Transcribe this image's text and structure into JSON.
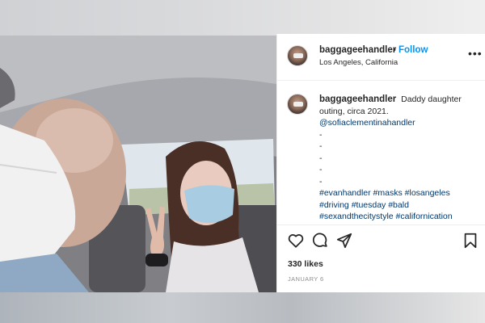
{
  "post": {
    "username": "baggageehandler",
    "dot": "•",
    "follow_label": "Follow",
    "location": "Los Angeles, California",
    "more_label": "•••",
    "caption": {
      "username": "baggageehandler",
      "text": "Daddy daughter outing, circa 2021.",
      "mention": "@sofiaclementinahandler",
      "dashes": [
        "-",
        "-",
        "-",
        "-",
        "-"
      ],
      "hashtags_line1": "#evanhandler #masks #losangeles",
      "hashtags_line2": "#driving #tuesday #bald",
      "hashtags_line3": "#sexandthecitystyle #californication"
    },
    "likes": "330 likes",
    "date": "JANUARY 6"
  },
  "icons": [
    "heart-icon",
    "comment-icon",
    "share-icon",
    "bookmark-icon",
    "more-icon"
  ],
  "colors": {
    "link": "#0095f6",
    "hashtag": "#00376b",
    "text": "#262626",
    "muted": "#8e8e8e"
  }
}
